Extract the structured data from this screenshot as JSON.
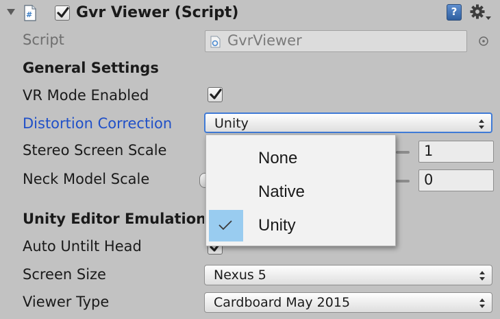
{
  "component": {
    "title": "Gvr Viewer (Script)",
    "enabled": true,
    "icons": [
      "foldout-arrow",
      "script-icon",
      "help-icon",
      "gear-icon"
    ]
  },
  "script_field": {
    "label": "Script",
    "value": "GvrViewer"
  },
  "general_settings": {
    "header": "General Settings",
    "vr_mode": {
      "label": "VR Mode Enabled",
      "checked": true
    },
    "distortion": {
      "label": "Distortion Correction",
      "value": "Unity"
    },
    "stereo_scale": {
      "label": "Stereo Screen Scale",
      "value": "1"
    },
    "neck_scale": {
      "label": "Neck Model Scale",
      "value": "0"
    }
  },
  "editor_emulation": {
    "header": "Unity Editor Emulation",
    "auto_untilt": {
      "label": "Auto Untilt Head",
      "checked": true
    },
    "screen_size": {
      "label": "Screen Size",
      "value": "Nexus 5"
    },
    "viewer_type": {
      "label": "Viewer Type",
      "value": "Cardboard May 2015"
    }
  },
  "dropdown": {
    "options": [
      "None",
      "Native",
      "Unity"
    ],
    "selected": "Unity"
  },
  "colors": {
    "background": "#c2c2c2",
    "focused_label": "#2050c8",
    "focus_ring": "#3f7ad6",
    "selection": "#99ccf0"
  }
}
